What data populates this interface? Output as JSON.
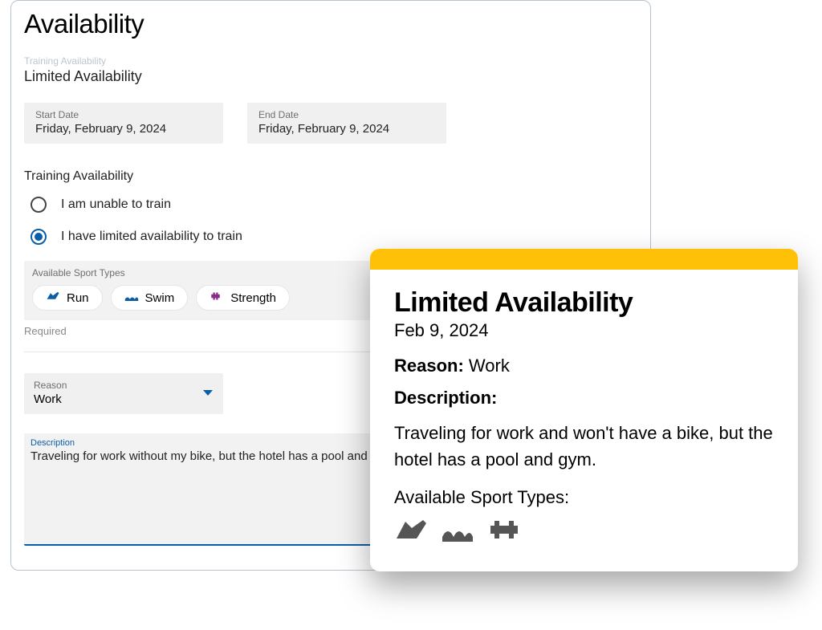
{
  "form": {
    "page_title": "Availability",
    "subheader_label": "Training Availability",
    "subheader_value": "Limited Availability",
    "start_date": {
      "label": "Start Date",
      "value": "Friday, February 9, 2024"
    },
    "end_date": {
      "label": "End Date",
      "value": "Friday, February 9, 2024"
    },
    "radio_section_label": "Training Availability",
    "radio_options": {
      "unable": "I am unable to train",
      "limited": "I have limited availability to train"
    },
    "selected_radio": "limited",
    "sport_types": {
      "label": "Available Sport Types",
      "items": {
        "run": "Run",
        "swim": "Swim",
        "strength": "Strength"
      }
    },
    "required_note": "Required",
    "reason": {
      "label": "Reason",
      "value": "Work"
    },
    "description": {
      "label": "Description",
      "value": "Traveling for work without my bike, but the hotel has a pool and a gym"
    }
  },
  "summary": {
    "title": "Limited Availability",
    "date": "Feb 9, 2024",
    "reason_label": "Reason:",
    "reason_value": "Work",
    "description_label": "Description:",
    "description_value": "Traveling for work and won't have a bike, but the hotel has a pool and gym.",
    "sports_label": "Available Sport Types:"
  }
}
